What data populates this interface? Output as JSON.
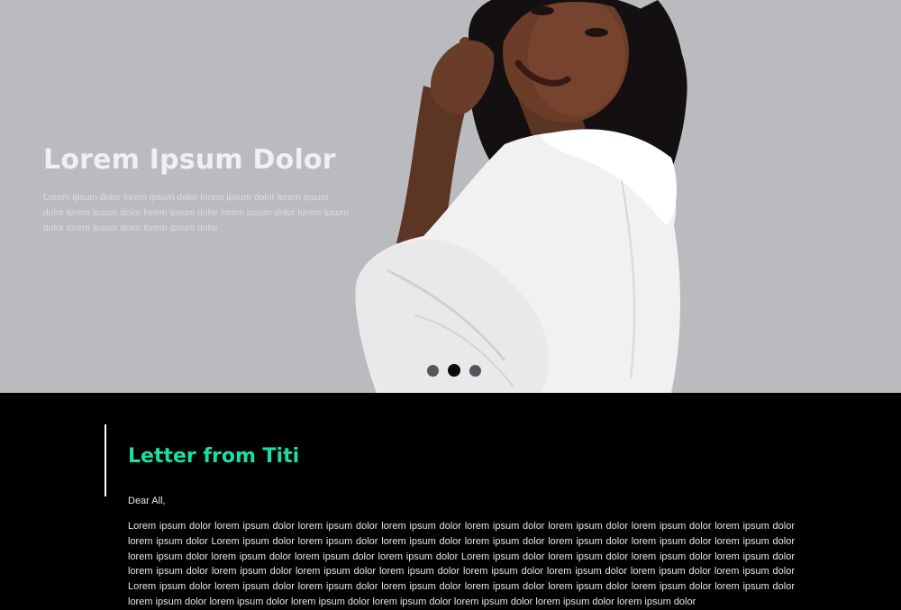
{
  "hero": {
    "title": "Lorem Ipsum Dolor",
    "text": "Lorem ipsum dolor lorem ipsum dolor lorem ipsum dolor lorem ipsum dolor lorem ipsum dolor lorem ipsum dolor lorem ipsum dolor lorem ipsum dolor lorem ipsum dolor lorem ipsum dolor",
    "slide_count": 3,
    "active_slide": 2,
    "background_color": "#b9bbbf"
  },
  "letter": {
    "title": "Letter from Titi",
    "accent_color": "#16e0a8",
    "greeting": "Dear All,",
    "body": "Lorem ipsum dolor lorem ipsum dolor lorem ipsum dolor lorem ipsum dolor lorem ipsum dolor lorem ipsum dolor lorem ipsum dolor lorem ipsum dolor lorem ipsum dolor Lorem ipsum dolor lorem ipsum dolor lorem ipsum dolor lorem ipsum dolor lorem ipsum dolor lorem ipsum dolor lorem ipsum dolor lorem ipsum dolor lorem ipsum dolor lorem ipsum dolor lorem ipsum dolor Lorem ipsum dolor lorem ipsum dolor lorem ipsum dolor lorem ipsum dolor lorem ipsum dolor lorem ipsum dolor lorem ipsum dolor lorem ipsum dolor lorem ipsum dolor lorem ipsum dolor lorem ipsum dolor lorem ipsum dolor Lorem ipsum dolor lorem ipsum dolor lorem ipsum dolor lorem ipsum dolor lorem ipsum dolor lorem ipsum dolor lorem ipsum dolor lorem ipsum dolor lorem ipsum dolor lorem ipsum dolor lorem ipsum dolor lorem ipsum dolor lorem ipsum dolor lorem ipsum dolor lorem ipsum dolor"
  }
}
